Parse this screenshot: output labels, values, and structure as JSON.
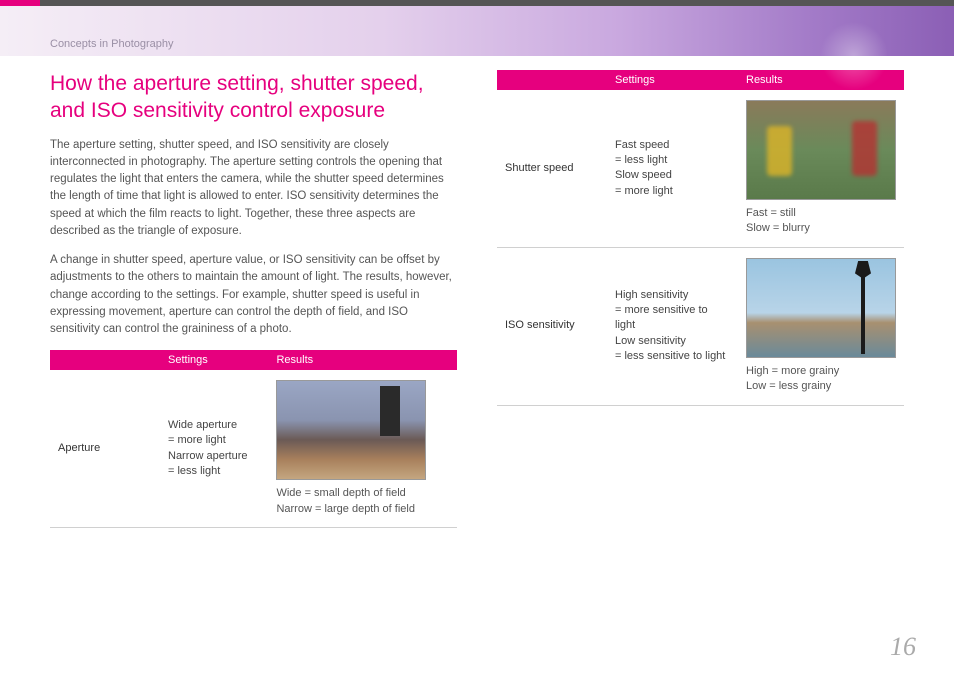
{
  "breadcrumb": "Concepts in Photography",
  "title": "How the aperture setting, shutter speed, and ISO sensitivity control exposure",
  "para1": "The aperture setting, shutter speed, and ISO sensitivity are closely interconnected in photography. The aperture setting controls the opening that regulates the light that enters the camera, while the shutter speed determines the length of time that light is allowed to enter. ISO sensitivity determines the speed at which the film reacts to light. Together, these three aspects are described as the triangle of exposure.",
  "para2": "A change in shutter speed, aperture value, or ISO sensitivity can be offset by adjustments to the others to maintain the amount of light. The results, however, change according to the settings. For example, shutter speed is useful in expressing movement, aperture can control the depth of field, and ISO sensitivity can control the graininess of a photo.",
  "table_headers": {
    "blank": "",
    "settings": "Settings",
    "results": "Results"
  },
  "rows": {
    "aperture": {
      "label": "Aperture",
      "settings": "Wide aperture\n= more light\nNarrow aperture\n= less light",
      "caption": "Wide = small depth of field\nNarrow = large depth of field"
    },
    "shutter": {
      "label": "Shutter speed",
      "settings": "Fast speed\n= less light\nSlow speed\n= more light",
      "caption": "Fast = still\nSlow = blurry"
    },
    "iso": {
      "label": "ISO sensitivity",
      "settings": "High sensitivity\n= more sensitive to light\nLow sensitivity\n= less sensitive to light",
      "caption": "High = more grainy\nLow = less grainy"
    }
  },
  "page_number": "16"
}
